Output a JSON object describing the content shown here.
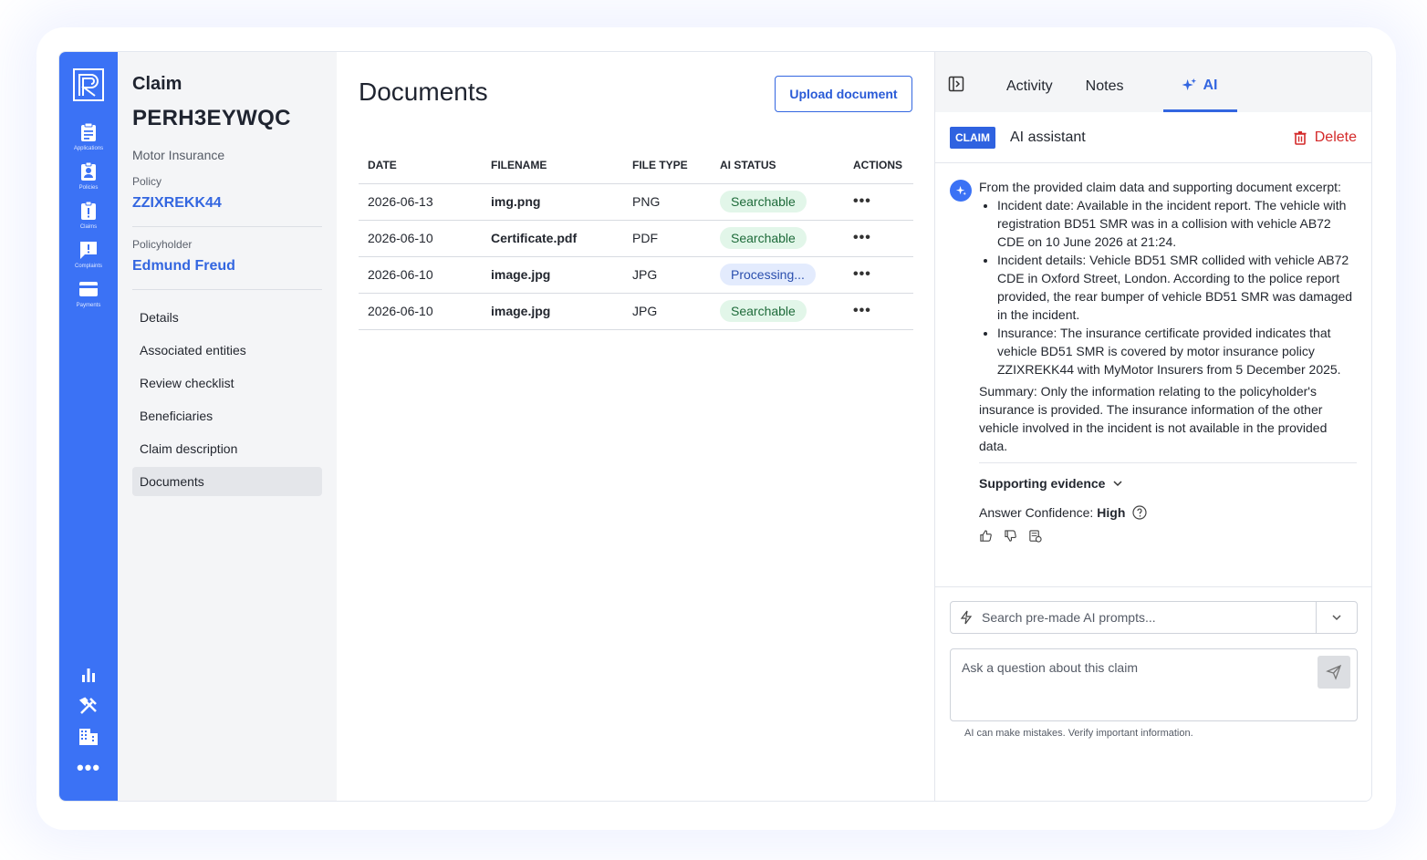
{
  "rail": {
    "items": [
      {
        "label": "Applications",
        "icon": "clipboard-icon"
      },
      {
        "label": "Policies",
        "icon": "id-badge-icon"
      },
      {
        "label": "Claims",
        "icon": "claim-alert-icon"
      },
      {
        "label": "Complaints",
        "icon": "chat-alert-icon"
      },
      {
        "label": "Payments",
        "icon": "credit-card-icon"
      }
    ],
    "bottom_icons": [
      "bar-chart-icon",
      "tools-icon",
      "building-icon",
      "more-icon"
    ]
  },
  "claim": {
    "heading": "Claim",
    "id": "PERH3EYWQC",
    "type": "Motor Insurance",
    "policy_label": "Policy",
    "policy_id": "ZZIXREKK44",
    "policyholder_label": "Policyholder",
    "policyholder_name": "Edmund Freud",
    "nav": [
      "Details",
      "Associated entities",
      "Review checklist",
      "Beneficiaries",
      "Claim description",
      "Documents"
    ],
    "active_nav": "Documents"
  },
  "documents": {
    "title": "Documents",
    "upload_label": "Upload document",
    "columns": [
      "DATE",
      "FILENAME",
      "FILE TYPE",
      "AI STATUS",
      "ACTIONS"
    ],
    "rows": [
      {
        "date": "2026-06-13",
        "filename": "img.png",
        "type": "PNG",
        "status": "Searchable"
      },
      {
        "date": "2026-06-10",
        "filename": "Certificate.pdf",
        "type": "PDF",
        "status": "Searchable"
      },
      {
        "date": "2026-06-10",
        "filename": "image.jpg",
        "type": "JPG",
        "status": "Processing..."
      },
      {
        "date": "2026-06-10",
        "filename": "image.jpg",
        "type": "JPG",
        "status": "Searchable"
      }
    ],
    "actions_glyph": "•••"
  },
  "ai_panel": {
    "tabs": [
      "Activity",
      "Notes",
      "AI"
    ],
    "active_tab": "AI",
    "badge": "CLAIM",
    "title": "AI assistant",
    "delete_label": "Delete",
    "intro": "From the provided claim data and supporting document excerpt:",
    "bullets": [
      "Incident date: Available in the incident report. The vehicle with registration BD51 SMR was in a collision with vehicle AB72 CDE on 10 June 2026 at 21:24.",
      "Incident details: Vehicle BD51 SMR collided with vehicle AB72 CDE in Oxford Street, London. According to the police report provided, the rear bumper of vehicle BD51 SMR was damaged in the incident.",
      "Insurance: The insurance certificate provided indicates that vehicle BD51 SMR is covered by motor insurance policy ZZIXREKK44 with MyMotor Insurers from 5 December 2025."
    ],
    "summary": "Summary: Only the information relating to the policyholder's insurance is provided. The insurance information of the other vehicle involved in the incident is not available in the provided data.",
    "evidence_label": "Supporting evidence",
    "confidence_label": "Answer Confidence:",
    "confidence_value": "High",
    "prompt_placeholder": "Search pre-made AI prompts...",
    "question_placeholder": "Ask a question about this claim",
    "disclaimer": "AI can make mistakes. Verify important information."
  },
  "colors": {
    "brand": "#3b72f5",
    "link": "#3366e0",
    "danger": "#d42a2a",
    "searchable_bg": "#e2f6e9",
    "processing_bg": "#e3ebfd"
  }
}
